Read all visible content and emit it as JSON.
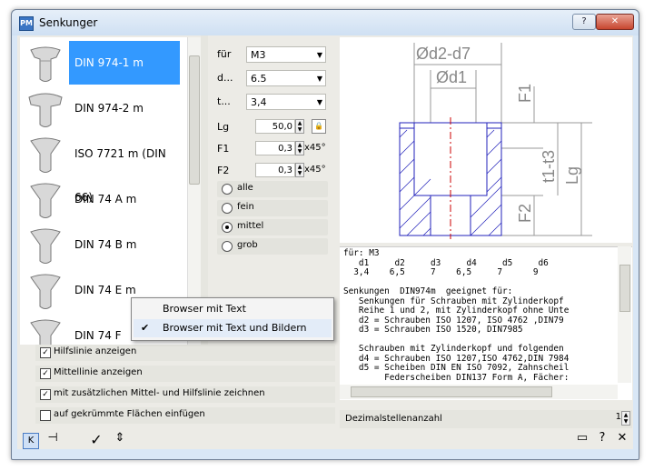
{
  "window": {
    "title": "Senkunger",
    "app_icon_text": "PM",
    "help_btn": "?",
    "close_btn": "✕"
  },
  "list": {
    "items": [
      {
        "label": "DIN 974-1 m",
        "selected": true
      },
      {
        "label": "DIN 974-2 m",
        "selected": false
      },
      {
        "label": "ISO 7721 m (DIN 66)",
        "selected": false
      },
      {
        "label": "DIN 74 A m",
        "selected": false
      },
      {
        "label": "DIN 74 B m",
        "selected": false
      },
      {
        "label": "DIN 74 E m",
        "selected": false
      },
      {
        "label": "DIN 74 F",
        "selected": false
      }
    ]
  },
  "params": {
    "fuer": {
      "label": "für",
      "value": "M3"
    },
    "d": {
      "label": "d...",
      "value": "6.5"
    },
    "t": {
      "label": "t...",
      "value": "3,4"
    },
    "lg": {
      "label": "Lg",
      "value": "50,0"
    },
    "f1": {
      "label": "F1",
      "value": "0,3",
      "unit": "x45°"
    },
    "f2": {
      "label": "F2",
      "value": "0,3",
      "unit": "x45°"
    },
    "radios": [
      {
        "label": "alle",
        "on": false
      },
      {
        "label": "fein",
        "on": false
      },
      {
        "label": "mittel",
        "on": true
      },
      {
        "label": "grob",
        "on": false
      }
    ]
  },
  "checks": [
    {
      "label": "Hilfslinie anzeigen",
      "checked": true
    },
    {
      "label": "Mittellinie anzeigen",
      "checked": true
    },
    {
      "label": "mit zusätzlichen Mittel- und Hilfslinie zeichnen",
      "checked": true
    },
    {
      "label": "auf gekrümmte Flächen einfügen",
      "checked": false
    }
  ],
  "drawing": {
    "dims": {
      "od2d7": "Ød2-d7",
      "od1": "Ød1",
      "f1": "F1",
      "t1t3": "t1-t3",
      "lg": "Lg",
      "f2": "F2"
    },
    "colors": {
      "part": "#2222bb",
      "dim": "#999999",
      "axis": "#cc0000"
    }
  },
  "text": "für: M3\n   d1     d2     d3     d4     d5     d6\n  3,4    6,5     7    6,5     7      9\n\nSenkungen  DIN974m  geeignet für:\n   Senkungen für Schrauben mit Zylinderkopf\n   Reihe 1 und 2, mit Zylinderkopf ohne Unte\n   d2 = Schrauben ISO 1207, ISO 4762 ,DIN79\n   d3 = Schrauben ISO 1520, DIN7985\n\n   Schrauben mit Zylinderkopf und folgenden\n   d4 = Schrauben ISO 1207,ISO 4762,DIN 7984\n   d5 = Scheiben DIN EN ISO 7092, Zahnscheil\n        Federscheiben DIN137 Form A, Fächer:",
  "dezimal": {
    "label": "Dezimalstellenanzahl",
    "value": "1"
  },
  "menu": {
    "items": [
      {
        "label": "Browser mit Text",
        "checked": false
      },
      {
        "label": "Browser mit Text und Bildern",
        "checked": true
      }
    ]
  },
  "toolbar": {
    "back_icon": "K",
    "pin_icon": "⊣",
    "ok_icon": "✓",
    "insert_icon": "⇕",
    "min_icon": "▭",
    "help_icon": "?",
    "close_icon": "✕"
  }
}
